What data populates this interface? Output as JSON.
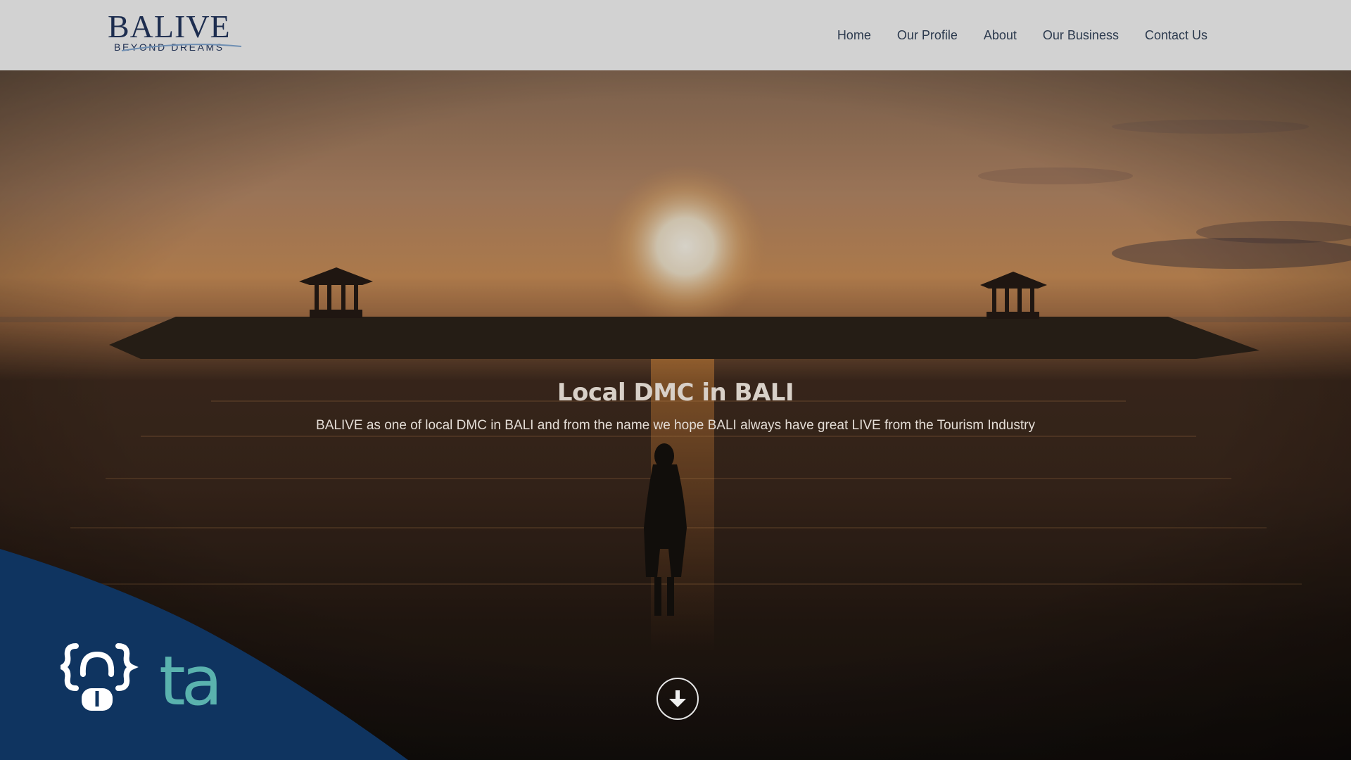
{
  "brand": {
    "logo_main": "BALIVE",
    "logo_sub": "BEYOND DREAMS"
  },
  "nav": {
    "items": [
      {
        "label": "Home"
      },
      {
        "label": "Our Profile"
      },
      {
        "label": "About"
      },
      {
        "label": "Our Business"
      },
      {
        "label": "Contact Us"
      }
    ]
  },
  "hero": {
    "title": "Local DMC in BALI",
    "subtitle": "BALIVE as one of local DMC in BALI and from the name we hope BALI always have great LIVE from the Tourism Industry",
    "scroll_icon": "arrow-down-circle-icon"
  },
  "corner_badge": {
    "icon": "code-bracket-face-icon",
    "ta_text": "ta"
  },
  "colors": {
    "header_bg": "#d2d2d2",
    "brand_navy": "#1d2d4f",
    "corner_navy": "#0f3460",
    "teal": "#5ab2ae"
  }
}
